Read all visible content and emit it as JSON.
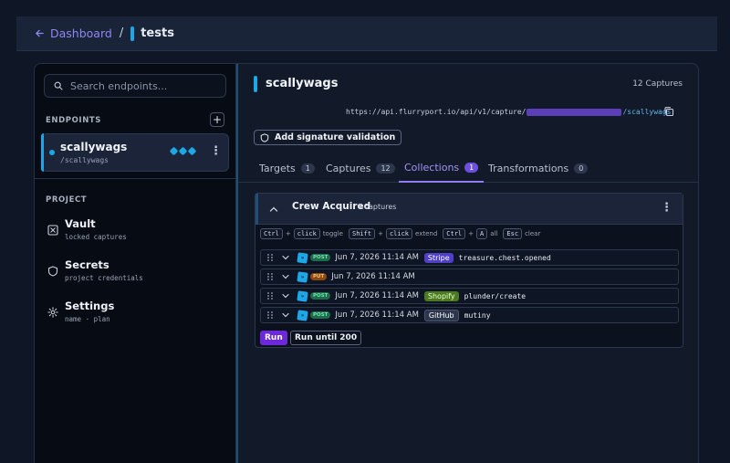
{
  "breadcrumb": {
    "back_label": "Dashboard",
    "separator": "/",
    "current": "tests"
  },
  "sidebar": {
    "search_placeholder": "Search endpoints...",
    "endpoints_label": "ENDPOINTS",
    "add_label": "+",
    "endpoint": {
      "name": "scallywags",
      "path": "/scallywags"
    },
    "project_label": "PROJECT",
    "nav": [
      {
        "title": "Vault",
        "subtitle": "locked captures",
        "icon": "vault-icon"
      },
      {
        "title": "Secrets",
        "subtitle": "project credentials",
        "icon": "shield-icon"
      },
      {
        "title": "Settings",
        "subtitle": "name · plan",
        "icon": "gear-icon"
      }
    ]
  },
  "main": {
    "title": "scallywags",
    "captures_count": "12 Captures",
    "url_prefix": "https://api.flurryport.io/api/v1/capture/",
    "url_slug": "/scallywags",
    "signature_label": "Add signature validation",
    "tabs": [
      {
        "label": "Targets",
        "count": "1"
      },
      {
        "label": "Captures",
        "count": "12"
      },
      {
        "label": "Collections",
        "count": "1",
        "active": true
      },
      {
        "label": "Transformations",
        "count": "0"
      }
    ],
    "collection": {
      "name": "Crew Acquired",
      "count_label": "4 captures",
      "shortcuts": {
        "k1": "Ctrl",
        "plus": "+",
        "k2": "click",
        "t1": "toggle",
        "k3": "Shift",
        "k4": "click",
        "t2": "extend",
        "k5": "Ctrl",
        "k6": "A",
        "t3": "all",
        "k7": "Esc",
        "t4": "clear"
      },
      "requests": [
        {
          "method": "POST",
          "timestamp": "Jun 7, 2026 11:14 AM",
          "source": "Stripe",
          "event": "treasure.chest.opened"
        },
        {
          "method": "PUT",
          "timestamp": "Jun 7, 2026 11:14 AM",
          "source": "",
          "event": ""
        },
        {
          "method": "POST",
          "timestamp": "Jun 7, 2026 11:14 AM",
          "source": "Shopify",
          "event": "plunder/create"
        },
        {
          "method": "POST",
          "timestamp": "Jun 7, 2026 11:14 AM",
          "source": "GitHub",
          "event": "mutiny"
        }
      ],
      "run_label": "Run",
      "run_until_label": "Run until 200"
    }
  },
  "colors": {
    "accent": "#1ea7e6",
    "purple": "#6d28d9",
    "tab_active": "#a393f7"
  }
}
